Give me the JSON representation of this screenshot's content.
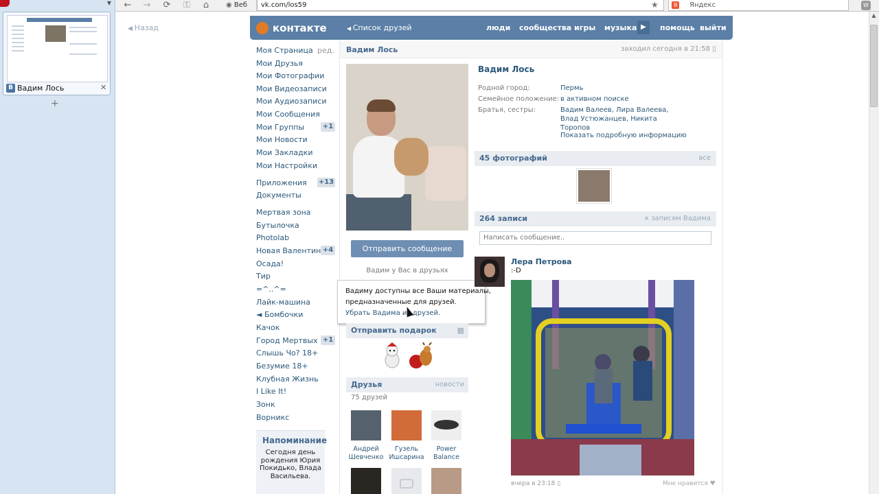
{
  "browser": {
    "tab_title": "Вадим Лось",
    "tab_favicon": "В",
    "address": "vk.com/los59",
    "web_label": "Веб",
    "search_placeholder": "Яндекс",
    "icons": [
      "back-icon",
      "forward-icon",
      "reload-icon",
      "key-icon",
      "home-icon",
      "star-icon",
      "yandex-icon",
      "opera-menu-icon"
    ]
  },
  "page": {
    "back": "Назад",
    "logo": "контакте",
    "header_links": {
      "friends_list": "Список друзей",
      "people": "люди",
      "communities": "сообщества",
      "games": "игры",
      "music": "музыка",
      "help": "помощь",
      "logout": "выйти"
    }
  },
  "menu": {
    "edit": "ред.",
    "items": [
      {
        "label": "Моя Страница",
        "badge": ""
      },
      {
        "label": "Мои Друзья",
        "badge": ""
      },
      {
        "label": "Мои Фотографии",
        "badge": ""
      },
      {
        "label": "Мои Видеозаписи",
        "badge": ""
      },
      {
        "label": "Мои Аудиозаписи",
        "badge": ""
      },
      {
        "label": "Мои Сообщения",
        "badge": ""
      },
      {
        "label": "Мои Группы",
        "badge": "+1"
      },
      {
        "label": "Мои Новости",
        "badge": ""
      },
      {
        "label": "Мои Закладки",
        "badge": ""
      },
      {
        "label": "Мои Настройки",
        "badge": ""
      }
    ],
    "apps": [
      {
        "label": "Приложения",
        "badge": "+13"
      },
      {
        "label": "Документы",
        "badge": ""
      }
    ],
    "groups": [
      {
        "label": "Мертвая зона",
        "badge": ""
      },
      {
        "label": "Бутылочка",
        "badge": ""
      },
      {
        "label": "Photolab",
        "badge": ""
      },
      {
        "label": "Новая Валентинка",
        "badge": "+4"
      },
      {
        "label": "Осада!",
        "badge": ""
      },
      {
        "label": "Тир",
        "badge": ""
      },
      {
        "label": "=^..^=",
        "badge": ""
      },
      {
        "label": "Лайк-машина",
        "badge": ""
      },
      {
        "label": "◄ Бомбочки",
        "badge": ""
      },
      {
        "label": "Качок",
        "badge": ""
      },
      {
        "label": "Город Мертвых",
        "badge": "+1"
      },
      {
        "label": "Слышь Чо? 18+",
        "badge": ""
      },
      {
        "label": "Безумие 18+",
        "badge": ""
      },
      {
        "label": "Клубная Жизнь",
        "badge": ""
      },
      {
        "label": "I Like It!",
        "badge": ""
      },
      {
        "label": "Зонк",
        "badge": ""
      },
      {
        "label": "Ворникс",
        "badge": ""
      }
    ],
    "reminder": {
      "title": "Напоминание",
      "text": "Сегодня день рождения Юрия Покидько, Влада Васильева."
    }
  },
  "profile": {
    "name": "Вадим Лось",
    "online": "заходил сегодня в 21:58",
    "send_message": "Отправить сообщение",
    "friend_status": "Вадим у Вас в друзьях",
    "tooltip": {
      "line1": "Вадиму доступны все Ваши материалы,",
      "line2": "предназначенные для друзей.",
      "link": "Убрать Вадима из друзей."
    },
    "gift_title": "Отправить подарок",
    "friends_title": "Друзья",
    "friends_right": "новости",
    "friends_count": "75 друзей",
    "friends": [
      {
        "first": "Андрей",
        "last": "Шевченко"
      },
      {
        "first": "Гузель",
        "last": "Ишсарина"
      },
      {
        "first": "Power",
        "last": "Balance"
      }
    ],
    "info": [
      {
        "label": "Родной город:",
        "value": "Пермь"
      },
      {
        "label": "Семейное положение:",
        "value": "в активном поиске"
      },
      {
        "label": "Братья, сестры:",
        "value": "Вадим Валеев, Лира Валеева, Влад Устюжанцев, Никита Торопов"
      }
    ],
    "more_info": "Показать подробную информацию",
    "photos_title": "45 фотографий",
    "photos_right": "все",
    "posts_title": "264 записи",
    "posts_right": "к записям Вадима",
    "post_placeholder": "Написать сообщение..",
    "post": {
      "author": "Лера Петрова",
      "text": ":-D",
      "date": "вчера в 23:18",
      "like": "Мне нравится"
    }
  }
}
